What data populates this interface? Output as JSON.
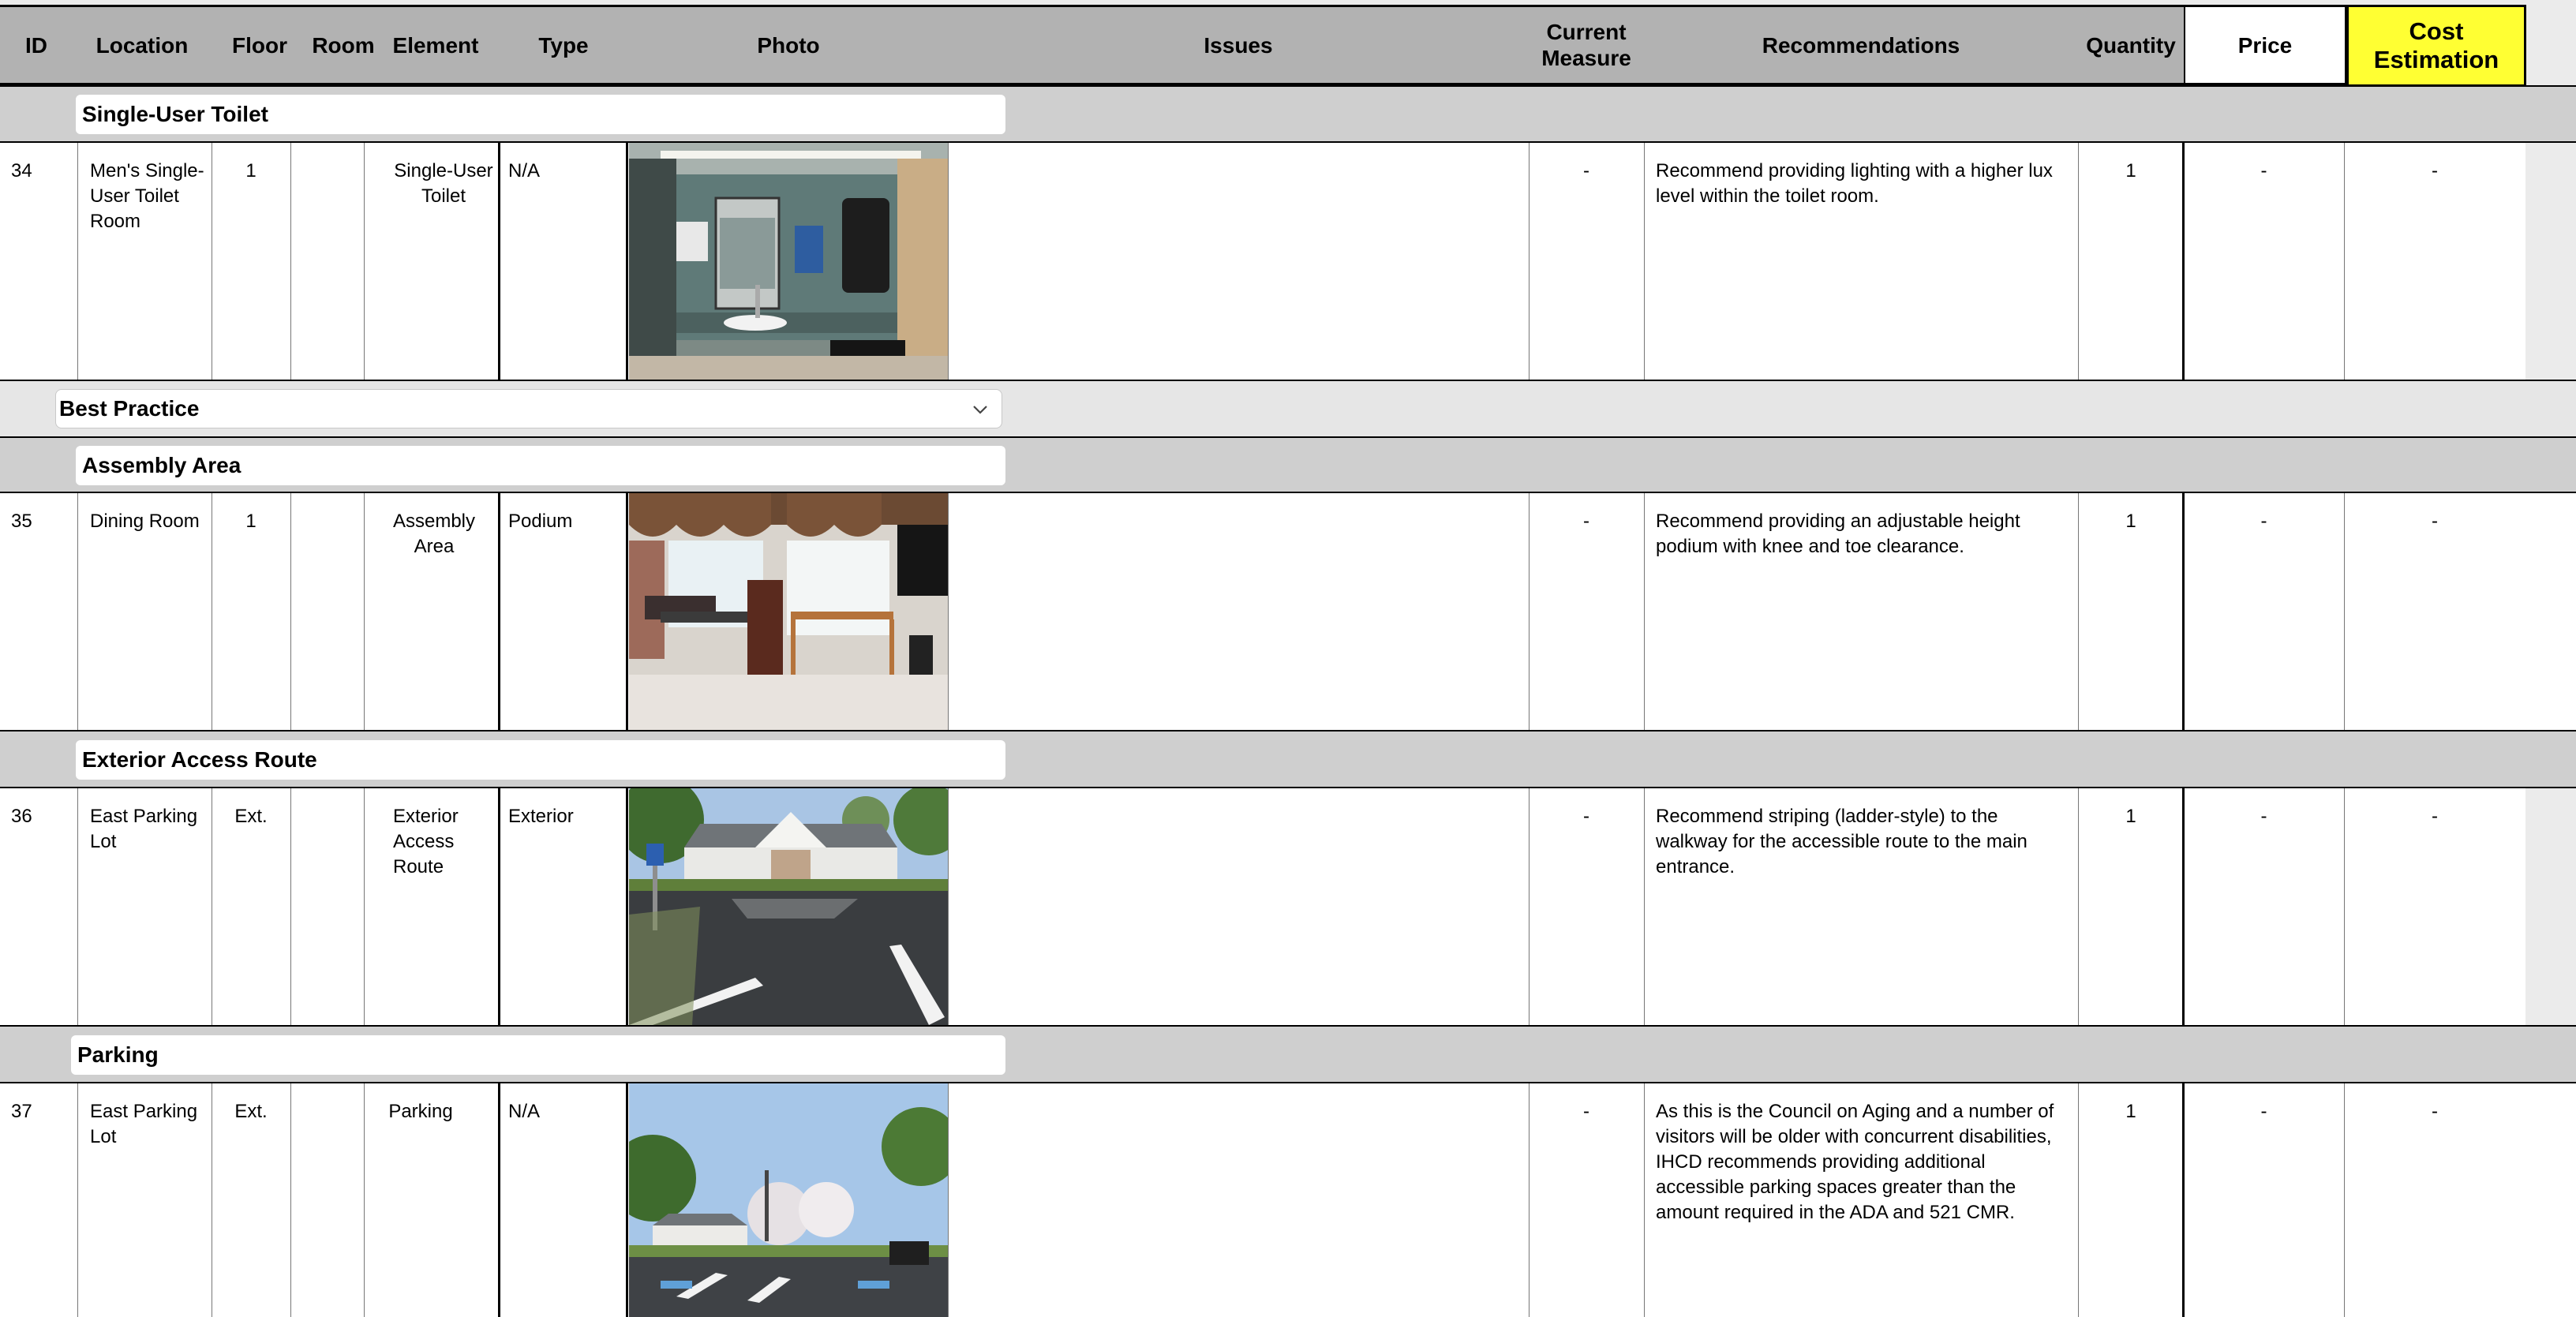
{
  "header": {
    "id": "ID",
    "location": "Location",
    "floor": "Floor",
    "room": "Room",
    "element": "Element",
    "type": "Type",
    "photo": "Photo",
    "issues": "Issues",
    "current_measure_line1": "Current",
    "current_measure_line2": "Measure",
    "recommendations": "Recommendations",
    "quantity": "Quantity",
    "price": "Price",
    "cost_line1": "Cost",
    "cost_line2": "Estimation"
  },
  "colors": {
    "header_bg": "#b2b2b2",
    "section_bg": "#cfcfcf",
    "cost_highlight": "#ffff33"
  },
  "sections": {
    "single_user_toilet": "Single-User Toilet",
    "best_practice": "Best Practice",
    "assembly_area": "Assembly Area",
    "exterior_access_route": "Exterior Access Route",
    "parking": "Parking"
  },
  "rows": [
    {
      "id": "34",
      "location": "Men's Single-User Toilet Room",
      "floor": "1",
      "room": "",
      "element": "Single-User Toilet",
      "type": "N/A",
      "photo_icon": "toilet-room-photo",
      "issues": "",
      "current_measure": "-",
      "recommendation": "Recommend providing lighting with a higher lux level within the toilet room.",
      "quantity": "1",
      "price": "-",
      "cost": "-"
    },
    {
      "id": "35",
      "location": "Dining Room",
      "floor": "1",
      "room": "",
      "element": "Assembly Area",
      "type": "Podium",
      "photo_icon": "dining-room-podium-photo",
      "issues": "",
      "current_measure": "-",
      "recommendation": "Recommend providing an adjustable height podium with knee and toe clearance.",
      "quantity": "1",
      "price": "-",
      "cost": "-"
    },
    {
      "id": "36",
      "location": "East Parking Lot",
      "floor": "Ext.",
      "room": "",
      "element": "Exterior Access Route",
      "type": "Exterior",
      "photo_icon": "parking-lot-walkway-photo",
      "issues": "",
      "current_measure": "-",
      "recommendation": "Recommend striping (ladder-style) to the walkway for the accessible route to the main entrance.",
      "quantity": "1",
      "price": "-",
      "cost": "-"
    },
    {
      "id": "37",
      "location": "East Parking Lot",
      "floor": "Ext.",
      "room": "",
      "element": "Parking",
      "type": "N/A",
      "photo_icon": "parking-lot-building-photo",
      "issues": "",
      "current_measure": "-",
      "recommendation": "As this is the Council on Aging and a number of visitors will be older with concurrent disabilities, IHCD recommends providing additional accessible parking spaces greater than the amount required in the ADA and 521 CMR.",
      "quantity": "1",
      "price": "-",
      "cost": "-"
    }
  ]
}
